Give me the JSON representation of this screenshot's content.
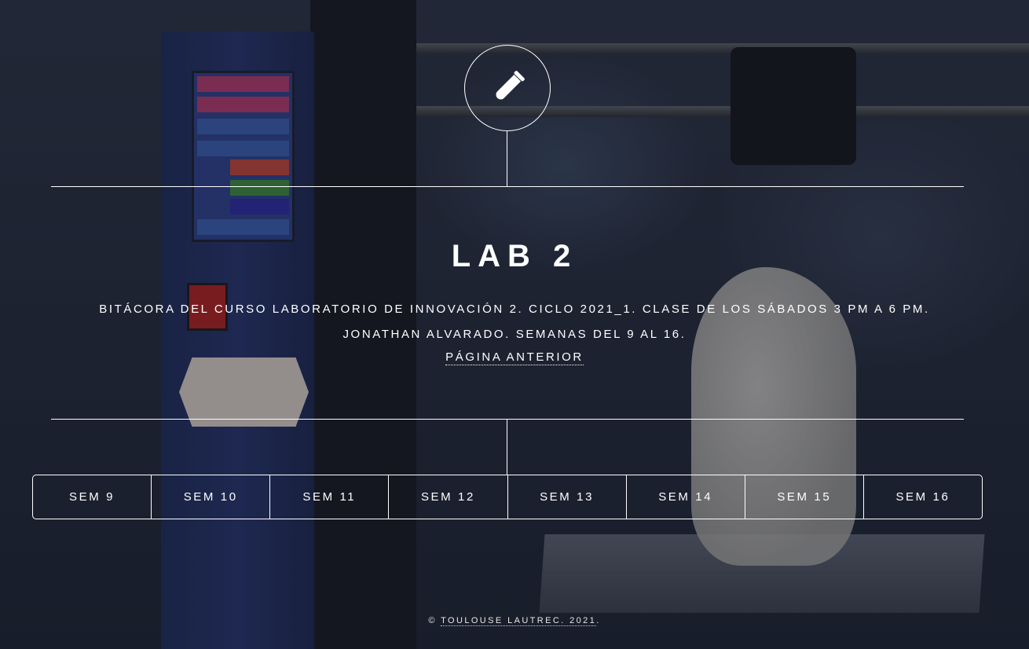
{
  "header": {
    "icon": "test-tube-icon"
  },
  "main": {
    "title": "LAB 2",
    "description_line1": "BITÁCORA DEL CURSO LABORATORIO DE INNOVACIÓN 2. CICLO 2021_1. CLASE DE LOS SÁBADOS 3 PM A 6 PM.",
    "description_line2": "JONATHAN ALVARADO. SEMANAS DEL 9 AL 16.",
    "prev_link": "PÁGINA ANTERIOR"
  },
  "nav": {
    "items": [
      {
        "label": "SEM 9"
      },
      {
        "label": "SEM 10"
      },
      {
        "label": "SEM 11"
      },
      {
        "label": "SEM 12"
      },
      {
        "label": "SEM 13"
      },
      {
        "label": "SEM 14"
      },
      {
        "label": "SEM 15"
      },
      {
        "label": "SEM 16"
      }
    ]
  },
  "footer": {
    "copyright_symbol": "©",
    "link_text": "TOULOUSE LAUTREC. 2021"
  },
  "colors": {
    "text": "#ffffff",
    "overlay": "#1e2433"
  }
}
